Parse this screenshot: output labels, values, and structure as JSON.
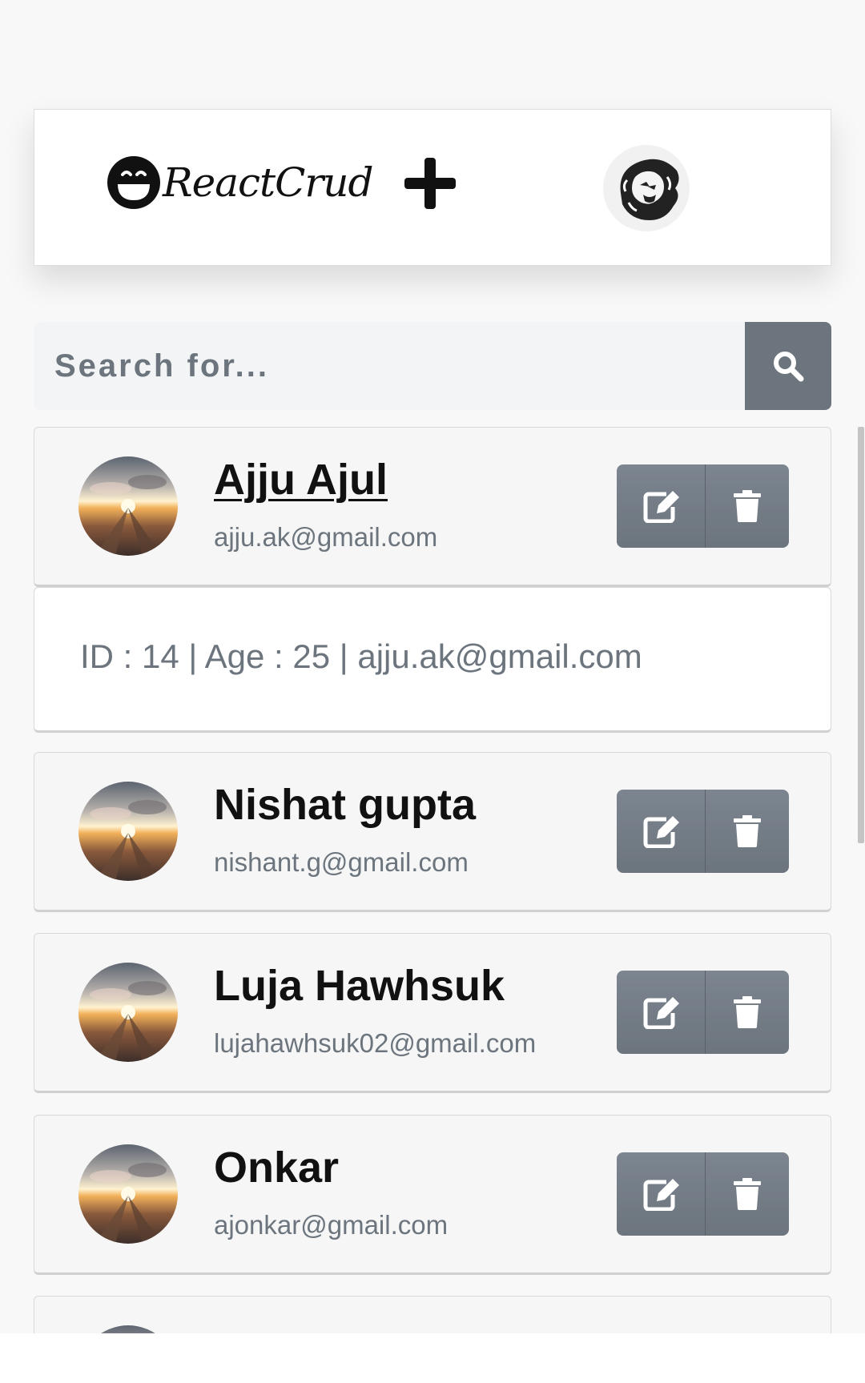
{
  "header": {
    "brand_text": "ReactCrud"
  },
  "search": {
    "placeholder": "Search for..."
  },
  "users": [
    {
      "name": "Ajju Ajul",
      "email": "ajju.ak@gmail.com"
    },
    {
      "name": "Nishat gupta",
      "email": "nishant.g@gmail.com"
    },
    {
      "name": "Luja Hawhsuk",
      "email": "lujahawhsuk02@gmail.com"
    },
    {
      "name": "Onkar",
      "email": "ajonkar@gmail.com"
    }
  ],
  "expanded_details": "ID : 14 | Age : 25 | ajju.ak@gmail.com",
  "icons": {
    "brand": "smiley-icon",
    "add": "plus-icon",
    "profile": "lion-avatar",
    "search": "search-icon",
    "edit": "edit-icon",
    "delete": "trash-icon"
  },
  "colors": {
    "button": "#6c757d",
    "text_muted": "#6c757d",
    "card_bg": "#f6f6f6"
  }
}
